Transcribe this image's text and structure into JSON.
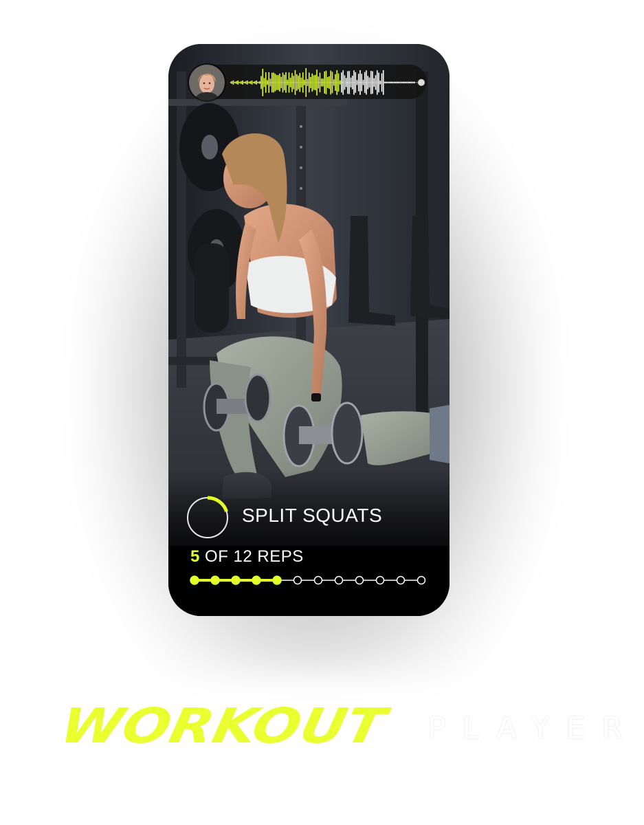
{
  "trainer": {
    "avatar_icon": "trainer-avatar-portrait",
    "waveform_icon": "audio-waveform"
  },
  "exercise": {
    "name": "SPLIT SQUATS",
    "timer_icon": "circular-timer-ring",
    "timer_progress": 0.2
  },
  "reps": {
    "current": "5",
    "suffix": " OF 12 REPS",
    "completed": 5,
    "total": 12
  },
  "branding": {
    "script_word": "WORKOUT",
    "light_word": "PLAYER"
  },
  "colors": {
    "accent": "#e3ff2b",
    "panel": "#000000",
    "text": "#ffffff"
  }
}
